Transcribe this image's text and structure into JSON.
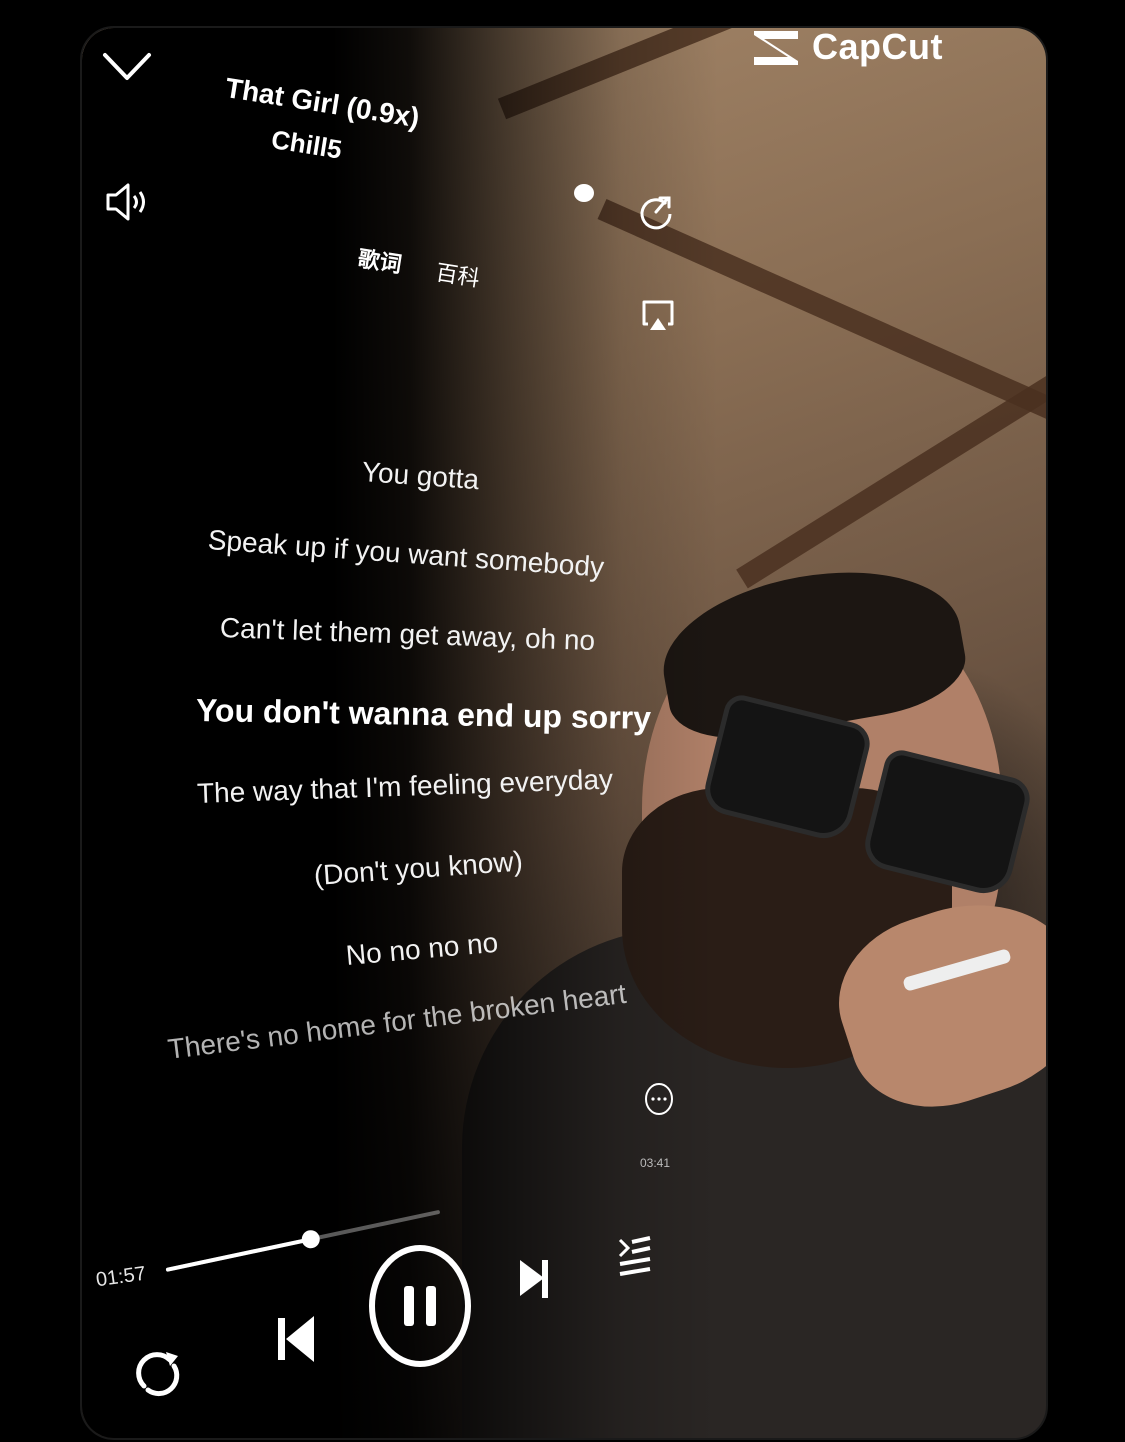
{
  "brand": {
    "name": "CapCut"
  },
  "track": {
    "title": "That Girl  (0.9x)",
    "artist": "Chill5",
    "tags": [
      "歌词",
      "百科"
    ]
  },
  "lyrics": [
    "You gotta",
    "Speak up if you want somebody",
    "Can't let them get away, oh no",
    "You don't wanna end up sorry",
    "The way that I'm feeling everyday",
    "(Don't you know)",
    "No no no no",
    "There's no home for the broken heart"
  ],
  "active_lyric_index": 3,
  "playback": {
    "elapsed": "01:57",
    "total": "03:41",
    "progress": 0.53,
    "state": "playing"
  },
  "icons": {
    "collapse": "chevron-down-icon",
    "volume": "speaker-icon",
    "share": "share-icon",
    "cast": "airplay-icon",
    "more": "more-icon",
    "repeat": "repeat-icon",
    "previous": "previous-icon",
    "pause": "pause-icon",
    "next": "next-icon",
    "playlist": "playlist-icon"
  },
  "colors": {
    "accent": "#ffffff",
    "background": "#000000"
  }
}
